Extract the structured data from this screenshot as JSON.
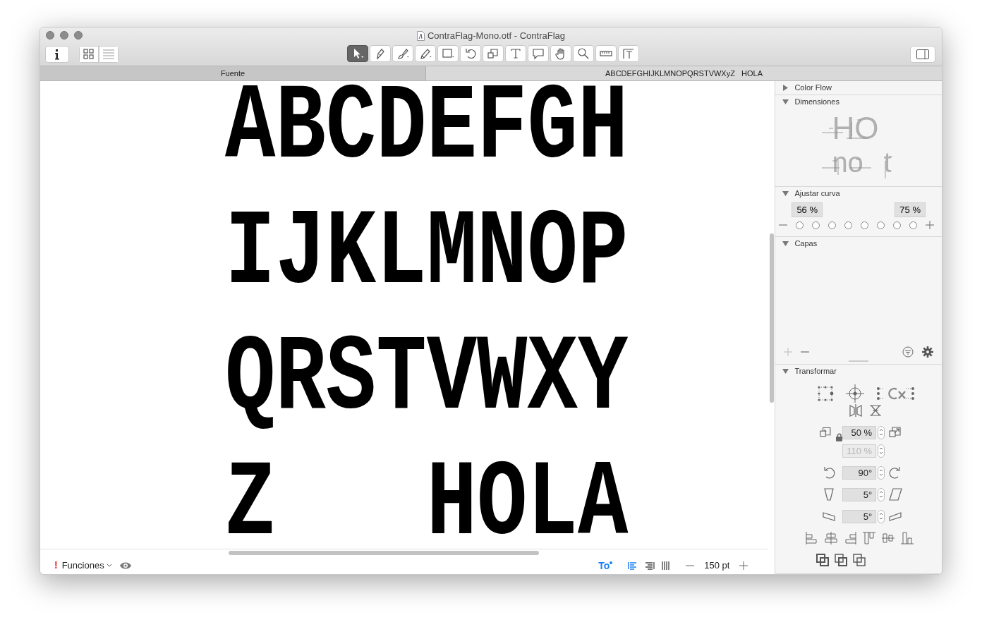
{
  "window": {
    "title": "ContraFlag-Mono.otf - ContraFlag"
  },
  "toolbar": {
    "left": [
      {
        "kind": "info",
        "selected": false
      },
      {
        "kind": "grid",
        "selected": false
      },
      {
        "kind": "list",
        "selected": false
      }
    ],
    "tools": [
      {
        "kind": "select",
        "selected": true
      },
      {
        "kind": "pen",
        "selected": false
      },
      {
        "kind": "brush",
        "selected": false
      },
      {
        "kind": "pencil",
        "selected": false
      },
      {
        "kind": "rect",
        "selected": false
      },
      {
        "kind": "rotate",
        "selected": false
      },
      {
        "kind": "scale",
        "selected": false
      },
      {
        "kind": "text",
        "selected": false
      },
      {
        "kind": "annotate",
        "selected": false
      },
      {
        "kind": "hand",
        "selected": false
      },
      {
        "kind": "zoom",
        "selected": false
      },
      {
        "kind": "ruler",
        "selected": false
      },
      {
        "kind": "metrics",
        "selected": false
      }
    ]
  },
  "tabs": [
    {
      "label": "Fuente",
      "selected": false
    },
    {
      "label": "ABCDEFGHIJKLMNOPQRSTVWXyZ   HOLA",
      "selected": true
    }
  ],
  "canvas": {
    "lines": [
      "ABCDEFGH",
      "IJKLMNOP",
      "QRSTVWXY",
      "Z   HOLA"
    ]
  },
  "bottom_bar": {
    "warning": "!",
    "features": "Funciones",
    "text_tool": "To",
    "zoom": "150 pt"
  },
  "sidebar": {
    "panels": [
      {
        "kind": "colorflow",
        "title": "Color Flow",
        "expanded": false
      },
      {
        "kind": "dimensions",
        "title": "Dimensiones",
        "expanded": true,
        "samples": [
          "HO",
          "no",
          "t"
        ]
      },
      {
        "kind": "curve",
        "title": "Ajustar curva",
        "expanded": true,
        "values": [
          "56 %",
          "75 %"
        ],
        "dots": [
          {
            "selected": false
          },
          {
            "selected": false
          },
          {
            "selected": false
          },
          {
            "selected": false
          },
          {
            "selected": false
          },
          {
            "selected": false
          },
          {
            "selected": false
          },
          {
            "selected": false
          }
        ]
      },
      {
        "kind": "layers",
        "title": "Capas",
        "expanded": true
      },
      {
        "kind": "transform",
        "title": "Transformar",
        "expanded": true,
        "fields": [
          {
            "kind": "scale",
            "value": "50 %",
            "disabled": false
          },
          {
            "kind": "scale2",
            "value": "110 %",
            "disabled": true
          },
          {
            "kind": "rotate",
            "value": "90°",
            "disabled": false
          },
          {
            "kind": "slant",
            "value": "5°",
            "disabled": false
          },
          {
            "kind": "slant2",
            "value": "5°",
            "disabled": false
          }
        ]
      }
    ]
  }
}
